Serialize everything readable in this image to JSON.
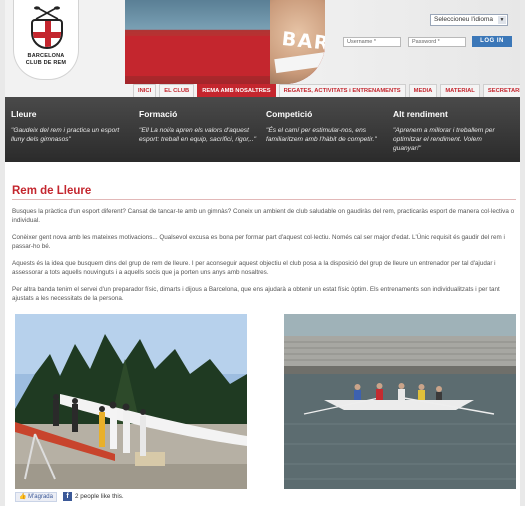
{
  "header": {
    "hero_title": "BARCELONA",
    "logo_text": [
      "BARCELONA",
      "CLUB DE REM"
    ],
    "language_select": "Seleccioneu l'idioma",
    "login": {
      "username_placeholder": "Username *",
      "password_placeholder": "Password *",
      "button": "LOG IN"
    }
  },
  "nav": [
    {
      "label": "INICI"
    },
    {
      "label": "EL CLUB"
    },
    {
      "label": "REMA AMB NOSALTRES",
      "active": true
    },
    {
      "label": "REGATES, ACTIVITATS i ENTRENAMENTS"
    },
    {
      "label": "MEDIA"
    },
    {
      "label": "MATERIAL"
    },
    {
      "label": "SECRETARIA"
    }
  ],
  "band": [
    {
      "title": "Lleure",
      "text": "\"Gaudeix del rem i practica un esport lluny dels gimnasos\""
    },
    {
      "title": "Formació",
      "text": "\"Ell La noi/a apren els valors d'aquest esport: treball en equip, sacrifici, rigor,..\""
    },
    {
      "title": "Competició",
      "text": "\"És el camí per estimular-nos, ens familiaritzem amb l'hàbit de competir.\""
    },
    {
      "title": "Alt rendiment",
      "text": "\"Aprenem a millorar i treballem per optimitzar el rendiment. Volem guanyar!\""
    }
  ],
  "article": {
    "title": "Rem de Lleure",
    "paragraphs": [
      "Busques la pràctica d'un esport diferent? Cansat de tancar-te amb un gimnàs? Coneix un ambient de club saludable on gaudiràs del rem, practicaràs esport de manera col·lectiva o individual.",
      "Conèixer gent nova amb les mateixes motivacions... Qualsevol excusa es bona per formar part d'aquest col·lectiu. Només cal ser major d'edat. L'Únic requisit és gaudir del rem i passar-ho bé.",
      "Aquests és la idea que busquem dins del grup de rem de lleure. I per aconseguir aquest objectiu el club posa a la disposició del grup de lleure un entrenador per tal d'ajudar i assessorar a tots aquells nouvinguts i a aquells socis que ja porten uns anys amb nosaltres.",
      "Per altra banda tenim el servei d'un preparador físic, dimarts i dijous a Barcelona, que ens ajudarà a obtenir un estat físic òptim. Els entrenaments son individualitzats i per tant ajustats a les necessitats de la persona."
    ]
  },
  "social": {
    "like_button": "M'agrada",
    "fb_icon": "f",
    "like_count_text": "2 people like this."
  },
  "colors": {
    "accent_red": "#c4262e",
    "band_dark": "#2b2b2b",
    "login_blue": "#3b77b8"
  }
}
